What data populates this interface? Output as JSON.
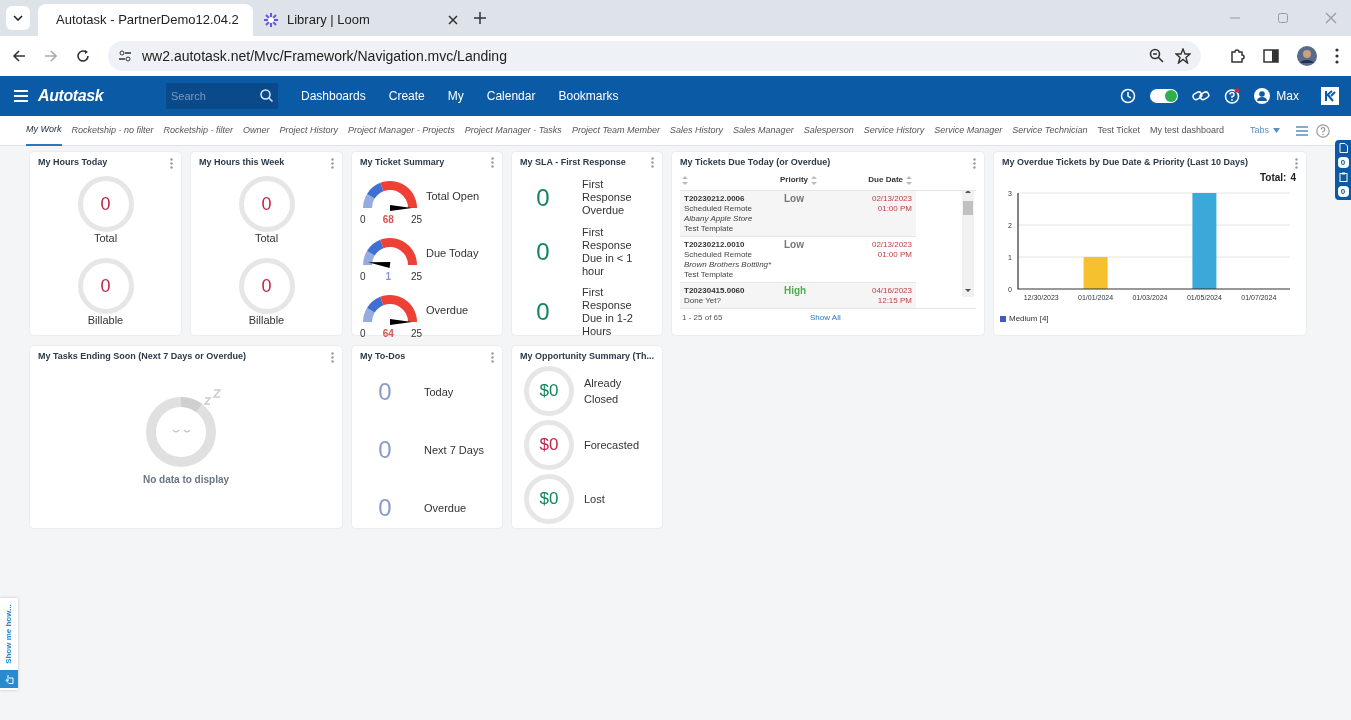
{
  "browser": {
    "tabs": [
      {
        "title": "Autotask - PartnerDemo12.04.2",
        "selected": true,
        "kind": "autotask"
      },
      {
        "title": "Library | Loom",
        "selected": false,
        "kind": "loom"
      }
    ],
    "url": "ww2.autotask.net/Mvc/Framework/Navigation.mvc/Landing"
  },
  "app_header": {
    "logo": "Autotask",
    "search": {
      "placeholder": "Search"
    },
    "menu": [
      "Dashboards",
      "Create",
      "My",
      "Calendar",
      "Bookmarks"
    ],
    "toggle_on": true,
    "user": "Max"
  },
  "dashboard_tabs": [
    {
      "label": "My Work",
      "selected": true,
      "italic": true
    },
    {
      "label": "Rocketship - no filter",
      "selected": false,
      "italic": true
    },
    {
      "label": "Rocketship - filter",
      "selected": false,
      "italic": true
    },
    {
      "label": "Owner",
      "selected": false,
      "italic": true
    },
    {
      "label": "Project History",
      "selected": false,
      "italic": true
    },
    {
      "label": "Project Manager - Projects",
      "selected": false,
      "italic": true
    },
    {
      "label": "Project Manager - Tasks",
      "selected": false,
      "italic": true
    },
    {
      "label": "Project Team Member",
      "selected": false,
      "italic": true
    },
    {
      "label": "Sales History",
      "selected": false,
      "italic": true
    },
    {
      "label": "Sales Manager",
      "selected": false,
      "italic": true
    },
    {
      "label": "Salesperson",
      "selected": false,
      "italic": true
    },
    {
      "label": "Service History",
      "selected": false,
      "italic": true
    },
    {
      "label": "Service Manager",
      "selected": false,
      "italic": true
    },
    {
      "label": "Service Technician",
      "selected": false,
      "italic": true
    },
    {
      "label": "Test Ticket",
      "selected": false,
      "italic": false
    },
    {
      "label": "My test dashboard",
      "selected": false,
      "italic": false
    }
  ],
  "tabs_menu": "Tabs",
  "widgets_row_1": [
    {
      "kind": "rings",
      "title": "My Hours Today",
      "items": [
        {
          "value": "0",
          "label": "Total",
          "color": "#c0264a"
        },
        {
          "value": "0",
          "label": "Billable",
          "color": "#c0264a"
        }
      ]
    },
    {
      "kind": "rings",
      "title": "My Hours this Week",
      "items": [
        {
          "value": "0",
          "label": "Total",
          "color": "#c0264a"
        },
        {
          "value": "0",
          "label": "Billable",
          "color": "#c0264a"
        }
      ]
    },
    {
      "kind": "gauges",
      "title": "My Ticket Summary",
      "items": [
        {
          "min": "0",
          "max": "25",
          "value": "68",
          "label": "Total Open",
          "color": "#d9534f"
        },
        {
          "min": "0",
          "max": "25",
          "value": "1",
          "label": "Due Today",
          "color": "#8a94c9"
        },
        {
          "min": "0",
          "max": "25",
          "value": "64",
          "label": "Overdue",
          "color": "#d9534f"
        }
      ]
    },
    {
      "kind": "counts",
      "title": "My SLA - First Response",
      "items": [
        {
          "value": "0",
          "label": "First Response Overdue",
          "color": "#11865a"
        },
        {
          "value": "0",
          "label": "First Response Due in < 1 hour",
          "color": "#11865a"
        },
        {
          "value": "0",
          "label": "First Response Due in 1-2 Hours",
          "color": "#11865a"
        }
      ]
    },
    {
      "kind": "tickets",
      "title": "My Tickets Due Today (or Overdue)",
      "columns": [
        "Priority",
        "Due Date"
      ],
      "rows": [
        {
          "number": "T20230212.0006",
          "type": "Scheduled Remote",
          "account": "Albany Apple Store",
          "template": "Test Template",
          "priority": {
            "text": "Low",
            "color": "#777777"
          },
          "due_date": "02/13/2023",
          "due_time": "01:00 PM"
        },
        {
          "number": "T20230212.0010",
          "type": "Scheduled Remote",
          "account": "Brown Brothers Bottling*",
          "template": "Test Template",
          "priority": {
            "text": "Low",
            "color": "#777777"
          },
          "due_date": "02/13/2023",
          "due_time": "01:00 PM"
        },
        {
          "number": "T20230415.0060",
          "type": "Done Yet?",
          "priority": {
            "text": "High",
            "color": "#4caf50"
          },
          "due_date": "04/16/2023",
          "due_time": "12:15 PM"
        }
      ],
      "paging": "1 - 25 of 65",
      "show_all": "Show All"
    },
    {
      "kind": "chart",
      "title": "My Overdue Tickets by Due Date & Priority (Last 10 Days)",
      "total_label": "Total:",
      "total": "4",
      "chart_data": {
        "type": "bar",
        "categories": [
          "12/30/2023",
          "01/01/2024",
          "01/03/2024",
          "01/05/2024",
          "01/07/2024"
        ],
        "series": [
          {
            "color": "#f6c12e",
            "values": [
              null,
              1,
              null,
              null,
              null
            ]
          },
          {
            "color": "#3aa8d8",
            "values": [
              null,
              null,
              null,
              3,
              null
            ]
          }
        ],
        "ylim": [
          0,
          3
        ],
        "yticks": [
          0,
          1,
          2,
          3
        ]
      },
      "legend": [
        {
          "label": "Medium [4]",
          "color": "#3b5cc0"
        }
      ]
    }
  ],
  "widgets_row_2": [
    {
      "kind": "empty",
      "title": "My Tasks Ending Soon (Next 7 Days or Overdue)",
      "message": "No data to display"
    },
    {
      "kind": "todos",
      "title": "My To-Dos",
      "items": [
        {
          "value": "0",
          "label": "Today",
          "color": "#8a9ccc"
        },
        {
          "value": "0",
          "label": "Next 7 Days",
          "color": "#8a9ccc"
        },
        {
          "value": "0",
          "label": "Overdue",
          "color": "#8a9ccc"
        }
      ]
    },
    {
      "kind": "money",
      "title": "My Opportunity Summary (Th...",
      "items": [
        {
          "value": "$0",
          "label": "Already Closed",
          "color": "#11865a"
        },
        {
          "value": "$0",
          "label": "Forecasted",
          "color": "#c0264a"
        },
        {
          "value": "$0",
          "label": "Lost",
          "color": "#11865a"
        }
      ]
    }
  ],
  "side_counters": [
    "0",
    "0"
  ],
  "help_tab": "Show me how..."
}
